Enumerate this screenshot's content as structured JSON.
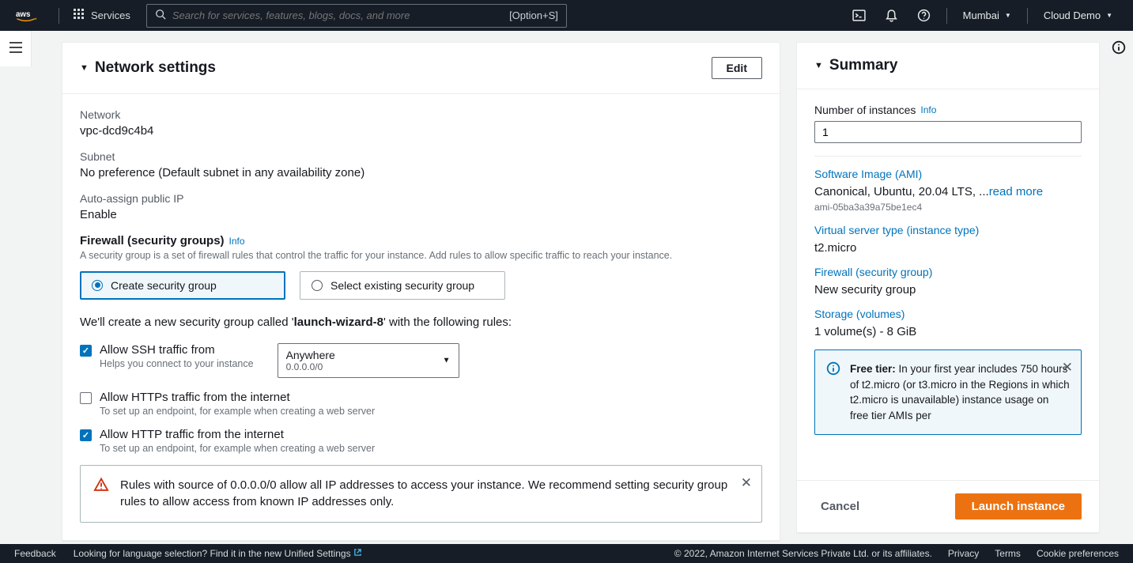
{
  "nav": {
    "services": "Services",
    "search_placeholder": "Search for services, features, blogs, docs, and more",
    "search_shortcut": "[Option+S]",
    "region": "Mumbai",
    "account": "Cloud Demo"
  },
  "network": {
    "panel_title": "Network settings",
    "edit": "Edit",
    "network_label": "Network",
    "network_value": "vpc-dcd9c4b4",
    "subnet_label": "Subnet",
    "subnet_value": "No preference (Default subnet in any availability zone)",
    "autoip_label": "Auto-assign public IP",
    "autoip_value": "Enable",
    "firewall_label": "Firewall (security groups)",
    "info": "Info",
    "firewall_help": "A security group is a set of firewall rules that control the traffic for your instance. Add rules to allow specific traffic to reach your instance.",
    "opt_create": "Create security group",
    "opt_select": "Select existing security group",
    "sg_text_pre": "We'll create a new security group called '",
    "sg_name": "launch-wizard-8",
    "sg_text_post": "' with the following rules:",
    "ssh_label": "Allow SSH traffic from",
    "ssh_help": "Helps you connect to your instance",
    "ssh_dd_label": "Anywhere",
    "ssh_dd_sub": "0.0.0.0/0",
    "https_label": "Allow HTTPs traffic from the internet",
    "https_help": "To set up an endpoint, for example when creating a web server",
    "http_label": "Allow HTTP traffic from the internet",
    "http_help": "To set up an endpoint, for example when creating a web server",
    "warn": "Rules with source of 0.0.0.0/0 allow all IP addresses to access your instance. We recommend setting security group rules to allow access from known IP addresses only."
  },
  "summary": {
    "title": "Summary",
    "num_label": "Number of instances",
    "info": "Info",
    "num_value": "1",
    "ami_link": "Software Image (AMI)",
    "ami_text": "Canonical, Ubuntu, 20.04 LTS, ...",
    "read_more": "read more",
    "ami_id": "ami-05ba3a39a75be1ec4",
    "type_link": "Virtual server type (instance type)",
    "type_val": "t2.micro",
    "sg_link": "Firewall (security group)",
    "sg_val": "New security group",
    "storage_link": "Storage (volumes)",
    "storage_val": "1 volume(s) - 8 GiB",
    "tier_label": "Free tier:",
    "tier_text": " In your first year includes 750 hours of t2.micro (or t3.micro in the Regions in which t2.micro is unavailable) instance usage on free tier AMIs per",
    "cancel": "Cancel",
    "launch": "Launch instance"
  },
  "footer": {
    "feedback": "Feedback",
    "lang_q": "Looking for language selection? Find it in the new ",
    "uset": "Unified Settings",
    "copyright": "© 2022, Amazon Internet Services Private Ltd. or its affiliates.",
    "privacy": "Privacy",
    "terms": "Terms",
    "cookie": "Cookie preferences"
  }
}
